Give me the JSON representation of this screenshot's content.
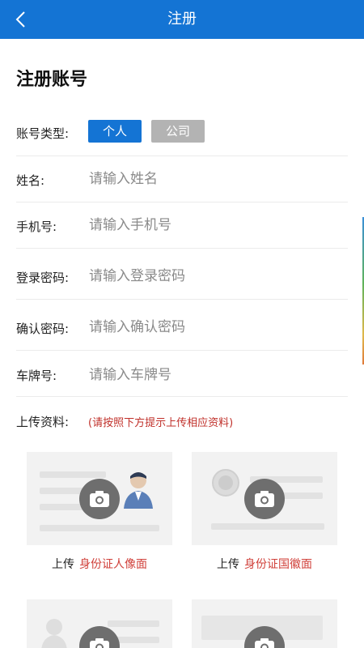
{
  "header": {
    "title": "注册",
    "back_icon": "chevron-left-icon"
  },
  "page_title": "注册账号",
  "account_type": {
    "label": "账号类型:",
    "options": [
      {
        "label": "个人",
        "selected": true
      },
      {
        "label": "公司",
        "selected": false
      }
    ]
  },
  "fields": [
    {
      "label": "姓名:",
      "placeholder": "请输入姓名"
    },
    {
      "label": "手机号:",
      "placeholder": "请输入手机号"
    },
    {
      "label": "登录密码:",
      "placeholder": "请输入登录密码"
    },
    {
      "label": "确认密码:",
      "placeholder": "请输入确认密码"
    },
    {
      "label": "车牌号:",
      "placeholder": "请输入车牌号"
    }
  ],
  "upload": {
    "label": "上传资料:",
    "hint": "(请按照下方提示上传相应资料)",
    "cards": [
      {
        "prefix": "上传",
        "name": "身份证人像面"
      },
      {
        "prefix": "上传",
        "name": "身份证国徽面"
      }
    ]
  },
  "colors": {
    "primary": "#1474d4",
    "hint_red": "#c0302a",
    "inactive_button": "#b3b3b3"
  }
}
